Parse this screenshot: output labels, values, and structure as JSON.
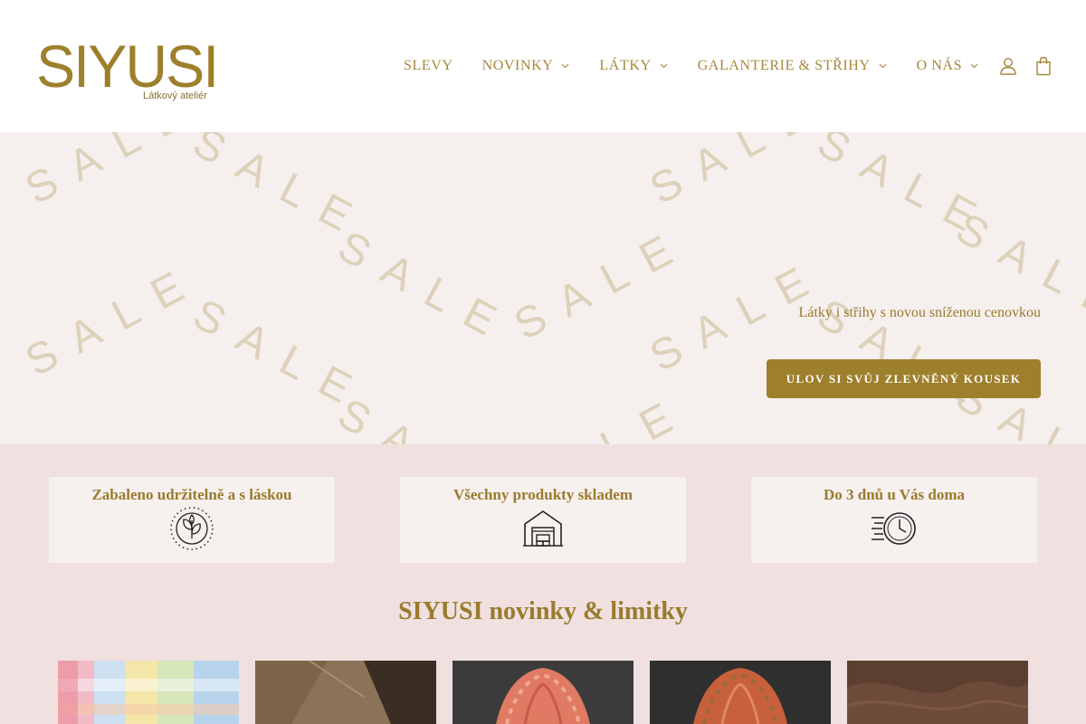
{
  "brand": {
    "name": "SIYUSI",
    "tagline": "Látkový ateliér",
    "color": "#9e7f2b"
  },
  "nav": {
    "items": [
      {
        "label": "SLEVY",
        "has_dropdown": false
      },
      {
        "label": "NOVINKY",
        "has_dropdown": true
      },
      {
        "label": "LÁTKY",
        "has_dropdown": true
      },
      {
        "label": "GALANTERIE & STŘIHY",
        "has_dropdown": true
      },
      {
        "label": "O NÁS",
        "has_dropdown": true
      }
    ],
    "icons": [
      "user-icon",
      "shopping-bag-icon"
    ]
  },
  "hero": {
    "background_word": "SALE",
    "text": "Látky i střihy s novou sníženou cenovkou",
    "button_label": "ULOV SI SVŮJ ZLEVNĚNÝ KOUSEK"
  },
  "features": [
    {
      "title": "Zabaleno udržitelně a s láskou",
      "icon": "leaf-icon"
    },
    {
      "title": "Všechny produkty skladem",
      "icon": "warehouse-icon"
    },
    {
      "title": "Do 3 dnů u Vás doma",
      "icon": "fast-clock-icon"
    }
  ],
  "section": {
    "title": "SIYUSI novinky & limitky"
  },
  "products": [
    {
      "icon": "fabric-checked-pastel-image"
    },
    {
      "icon": "fabric-brown-knit-image"
    },
    {
      "icon": "fabric-orange-stripe-image"
    },
    {
      "icon": "fabric-rust-stripe-image"
    },
    {
      "icon": "fabric-brown-velvet-image"
    }
  ],
  "colors": {
    "gold": "#9e7f2b",
    "hero_bg": "#f5efee",
    "band_bg": "#f0e0e0",
    "card_bg": "#f6f0ef",
    "sale_watermark": "#ddd1ba"
  }
}
